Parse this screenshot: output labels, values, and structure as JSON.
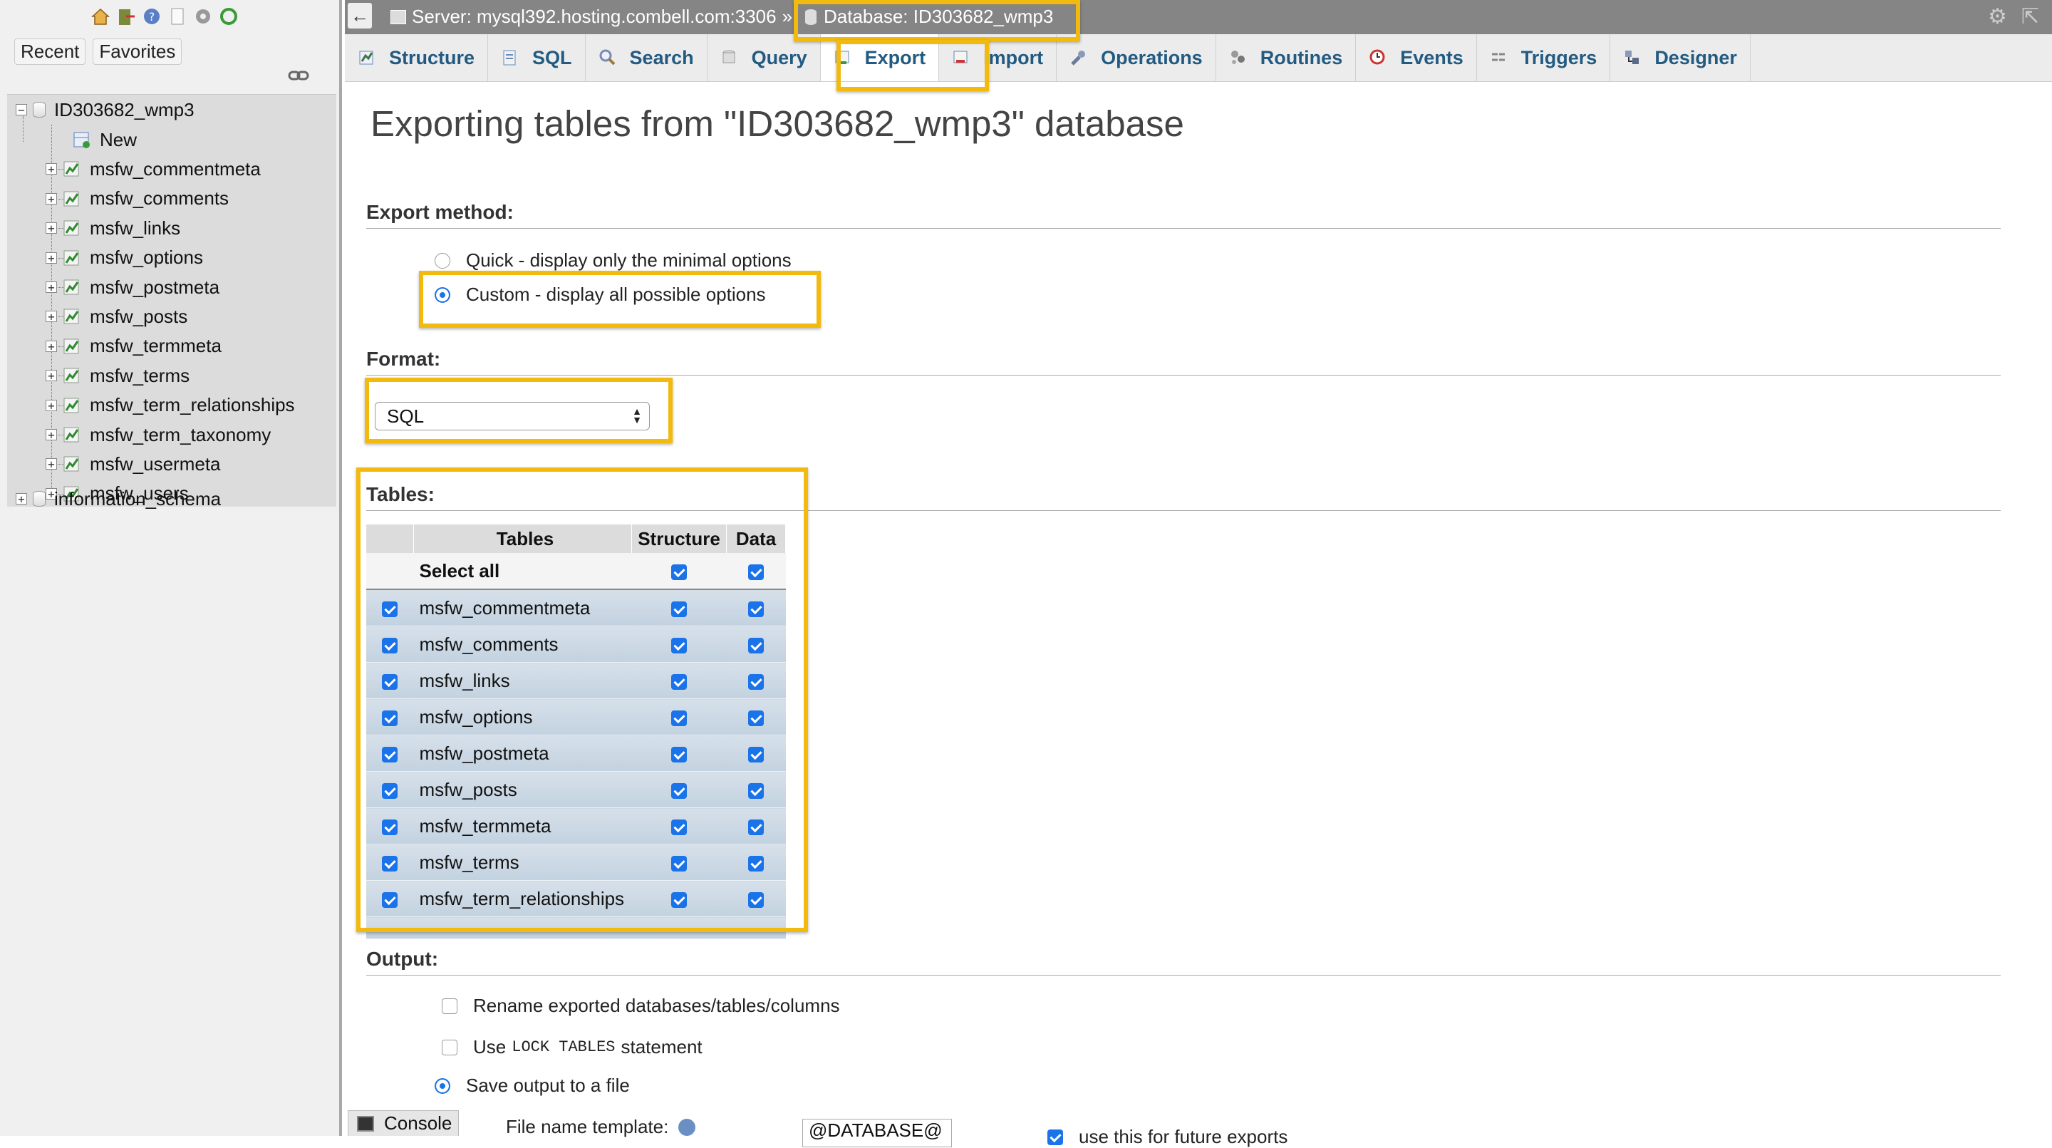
{
  "sidebar": {
    "nav_tabs": [
      "Recent",
      "Favorites"
    ],
    "top_icons": [
      "home-icon",
      "exit-icon",
      "help-icon",
      "docs-icon",
      "settings-icon",
      "reload-icon"
    ],
    "databases": [
      {
        "name": "ID303682_wmp3",
        "expanded": true,
        "children": [
          "New",
          "msfw_commentmeta",
          "msfw_comments",
          "msfw_links",
          "msfw_options",
          "msfw_postmeta",
          "msfw_posts",
          "msfw_termmeta",
          "msfw_terms",
          "msfw_term_relationships",
          "msfw_term_taxonomy",
          "msfw_usermeta",
          "msfw_users"
        ]
      },
      {
        "name": "information_schema",
        "expanded": false
      }
    ]
  },
  "breadcrumb": {
    "server": "Server: mysql392.hosting.combell.com:3306",
    "separator": "»",
    "database": "Database: ID303682_wmp3"
  },
  "tabs": [
    {
      "label": "Structure",
      "icon": "structure-icon"
    },
    {
      "label": "SQL",
      "icon": "sql-icon"
    },
    {
      "label": "Search",
      "icon": "search-icon"
    },
    {
      "label": "Query",
      "icon": "query-icon"
    },
    {
      "label": "Export",
      "icon": "export-icon",
      "active": true
    },
    {
      "label": "Import",
      "icon": "import-icon"
    },
    {
      "label": "Operations",
      "icon": "wrench-icon"
    },
    {
      "label": "Routines",
      "icon": "routines-icon"
    },
    {
      "label": "Events",
      "icon": "clock-icon"
    },
    {
      "label": "Triggers",
      "icon": "triggers-icon"
    },
    {
      "label": "Designer",
      "icon": "designer-icon"
    }
  ],
  "page": {
    "title": "Exporting tables from \"ID303682_wmp3\" database",
    "export_method": {
      "heading": "Export method:",
      "options": [
        {
          "label": "Quick - display only the minimal options",
          "selected": false
        },
        {
          "label": "Custom - display all possible options",
          "selected": true
        }
      ]
    },
    "format": {
      "heading": "Format:",
      "value": "SQL"
    },
    "tables": {
      "heading": "Tables:",
      "columns": [
        "Tables",
        "Structure",
        "Data"
      ],
      "select_all": "Select all",
      "rows": [
        "msfw_commentmeta",
        "msfw_comments",
        "msfw_links",
        "msfw_options",
        "msfw_postmeta",
        "msfw_posts",
        "msfw_termmeta",
        "msfw_terms",
        "msfw_term_relationships"
      ]
    },
    "output": {
      "heading": "Output:",
      "rename": "Rename exported databases/tables/columns",
      "lock_prefix": "Use",
      "lock_code": "LOCK TABLES",
      "lock_suffix": "statement",
      "save_to_file": "Save output to a file",
      "file_name_template_label": "File name template:",
      "file_name_template_value": "@DATABASE@",
      "future_exports": "use this for future exports"
    }
  },
  "console": {
    "label": "Console"
  },
  "colors": {
    "highlight": "#f2b90f",
    "link": "#235a81",
    "checkbox": "#1a73e8"
  }
}
